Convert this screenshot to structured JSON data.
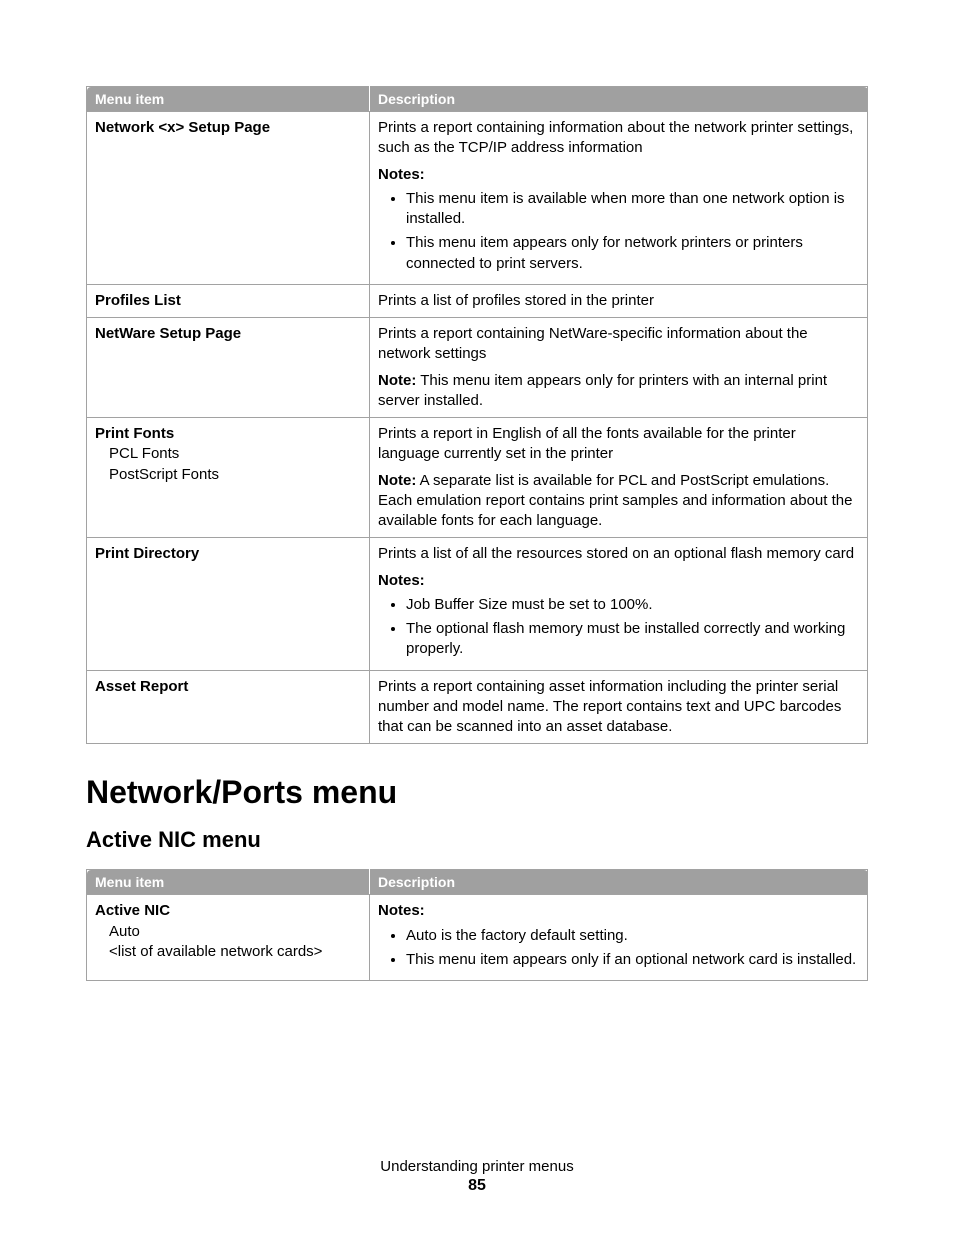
{
  "table1": {
    "headers": {
      "menu_item": "Menu item",
      "description": "Description"
    },
    "rows": [
      {
        "title": "Network <x> Setup Page",
        "desc": "Prints a report containing information about the network printer settings, such as the TCP/IP address information",
        "notes_label": "Notes:",
        "notes": [
          "This menu item is available when more than one network option is installed.",
          "This menu item appears only for network printers or printers connected to print servers."
        ]
      },
      {
        "title": "Profiles List",
        "desc": "Prints a list of profiles stored in the printer"
      },
      {
        "title": "NetWare Setup Page",
        "desc": "Prints a report containing NetWare-specific information about the network settings",
        "note_label": "Note:",
        "note_text": " This menu item appears only for printers with an internal print server installed."
      },
      {
        "title": "Print Fonts",
        "subs": [
          "PCL Fonts",
          "PostScript Fonts"
        ],
        "desc": "Prints a report in English of all the fonts available for the printer language currently set in the printer",
        "note_label": "Note:",
        "note_text": " A separate list is available for PCL and PostScript emulations. Each emulation report contains print samples and information about the available fonts for each language."
      },
      {
        "title": "Print Directory",
        "desc": "Prints a list of all the resources stored on an optional flash memory card",
        "notes_label": "Notes:",
        "notes": [
          "Job Buffer Size must be set to 100%.",
          "The optional flash memory must be installed correctly and working properly."
        ]
      },
      {
        "title": "Asset Report",
        "desc": "Prints a report containing asset information including the printer serial number and model name. The report contains text and UPC barcodes that can be scanned into an asset database."
      }
    ]
  },
  "section_heading": "Network/Ports menu",
  "subsection_heading": "Active NIC menu",
  "table2": {
    "headers": {
      "menu_item": "Menu item",
      "description": "Description"
    },
    "row": {
      "title": "Active NIC",
      "subs": [
        "Auto",
        "<list of available network cards>"
      ],
      "notes_label": "Notes:",
      "notes": [
        "Auto is the factory default setting.",
        "This menu item appears only if an optional network card is installed."
      ]
    }
  },
  "footer": {
    "text": "Understanding printer menus",
    "page": "85"
  }
}
